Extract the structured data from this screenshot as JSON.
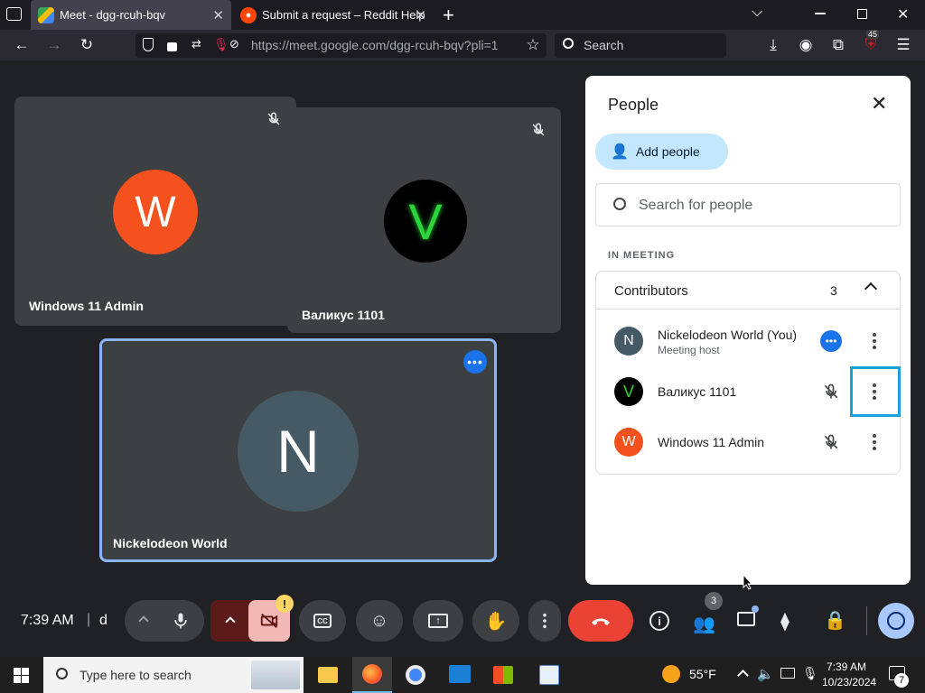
{
  "browser": {
    "tabs": [
      {
        "title": "Meet - dgg-rcuh-bqv",
        "active": true
      },
      {
        "title": "Submit a request – Reddit Help",
        "active": false
      }
    ],
    "url": "https://meet.google.com/dgg-rcuh-bqv?pli=1",
    "search_placeholder": "Search",
    "extension_badge": "45"
  },
  "meeting": {
    "tiles": [
      {
        "name": "Windows 11 Admin",
        "initial": "W",
        "avatar_color": "#f4511e"
      },
      {
        "name": "Валикус 1101",
        "initial": "V",
        "avatar_color": "#000000"
      },
      {
        "name": "Nickelodeon World",
        "initial": "N",
        "avatar_color": "#455a64"
      }
    ]
  },
  "people_panel": {
    "title": "People",
    "add_people_label": "Add people",
    "search_placeholder": "Search for people",
    "section_label": "IN MEETING",
    "group_label": "Contributors",
    "group_count": "3",
    "participants": [
      {
        "name": "Nickelodeon World (You)",
        "subtitle": "Meeting host",
        "initial": "N",
        "color": "#455a64"
      },
      {
        "name": "Валикус 1101",
        "subtitle": "",
        "initial": "V",
        "color": "#000000"
      },
      {
        "name": "Windows 11 Admin",
        "subtitle": "",
        "initial": "W",
        "color": "#f4511e"
      }
    ]
  },
  "controls": {
    "time": "7:39 AM",
    "separator": "|",
    "meeting_code_prefix": "d",
    "people_badge": "3",
    "camera_warning": "!"
  },
  "colors": {
    "accent_blue": "#1a73e8",
    "end_call_red": "#ea4335",
    "focus_cyan": "#1ba0d8"
  },
  "taskbar": {
    "search_placeholder": "Type here to search",
    "weather": "55°F",
    "clock_time": "7:39 AM",
    "clock_date": "10/23/2024",
    "notification_count": "7"
  }
}
